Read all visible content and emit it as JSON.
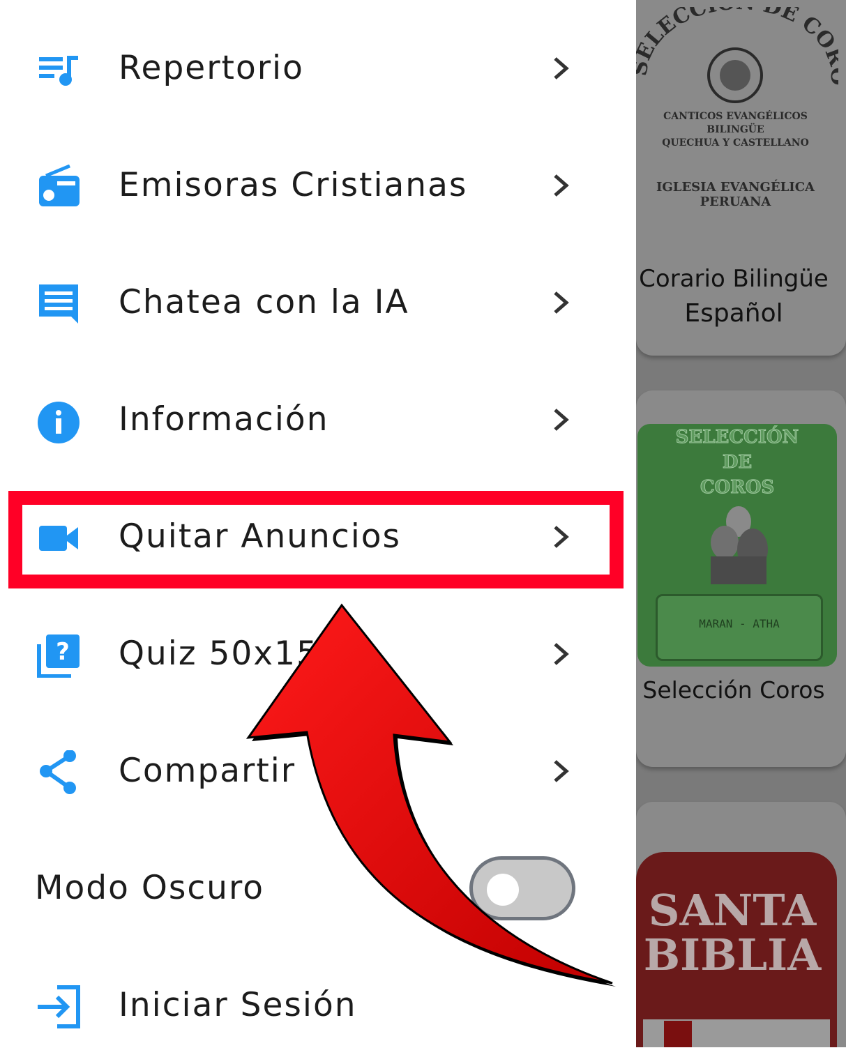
{
  "drawer": {
    "items": [
      {
        "label": "Repertorio",
        "icon": "playlist-music-icon"
      },
      {
        "label": "Emisoras Cristianas",
        "icon": "radio-icon"
      },
      {
        "label": "Chatea con la IA",
        "icon": "chat-icon"
      },
      {
        "label": "Información",
        "icon": "info-icon"
      },
      {
        "label": "Quitar Anuncios",
        "icon": "video-camera-icon"
      },
      {
        "label": "Quiz 50x15",
        "icon": "quiz-icon"
      },
      {
        "label": "Compartir",
        "icon": "share-icon"
      }
    ],
    "dark_mode": {
      "label": "Modo Oscuro",
      "enabled": false
    },
    "login": {
      "label": "Iniciar Sesión",
      "icon": "login-icon"
    }
  },
  "background": {
    "cards": [
      {
        "title_line1": "Corario Bilingüe",
        "title_line2": "Español",
        "cover_arc": "SELECCION DE COROS",
        "cover_lines": [
          "CANTICOS EVANGÉLICOS",
          "BILINGÜE",
          "QUECHUA Y CASTELLANO"
        ],
        "cover_footer": "IGLESIA EVANGÉLICA PERUANA"
      },
      {
        "title": "Selección Coros",
        "cover_lines": [
          "SELECCIÓN",
          "DE",
          "COROS"
        ],
        "cover_plaque": "MARAN - ATHA"
      },
      {
        "cover_lines": [
          "SANTA",
          "BIBLIA"
        ]
      }
    ]
  },
  "colors": {
    "accent": "#2196F3",
    "highlight": "#FF0026",
    "arrow": "#E00000"
  }
}
